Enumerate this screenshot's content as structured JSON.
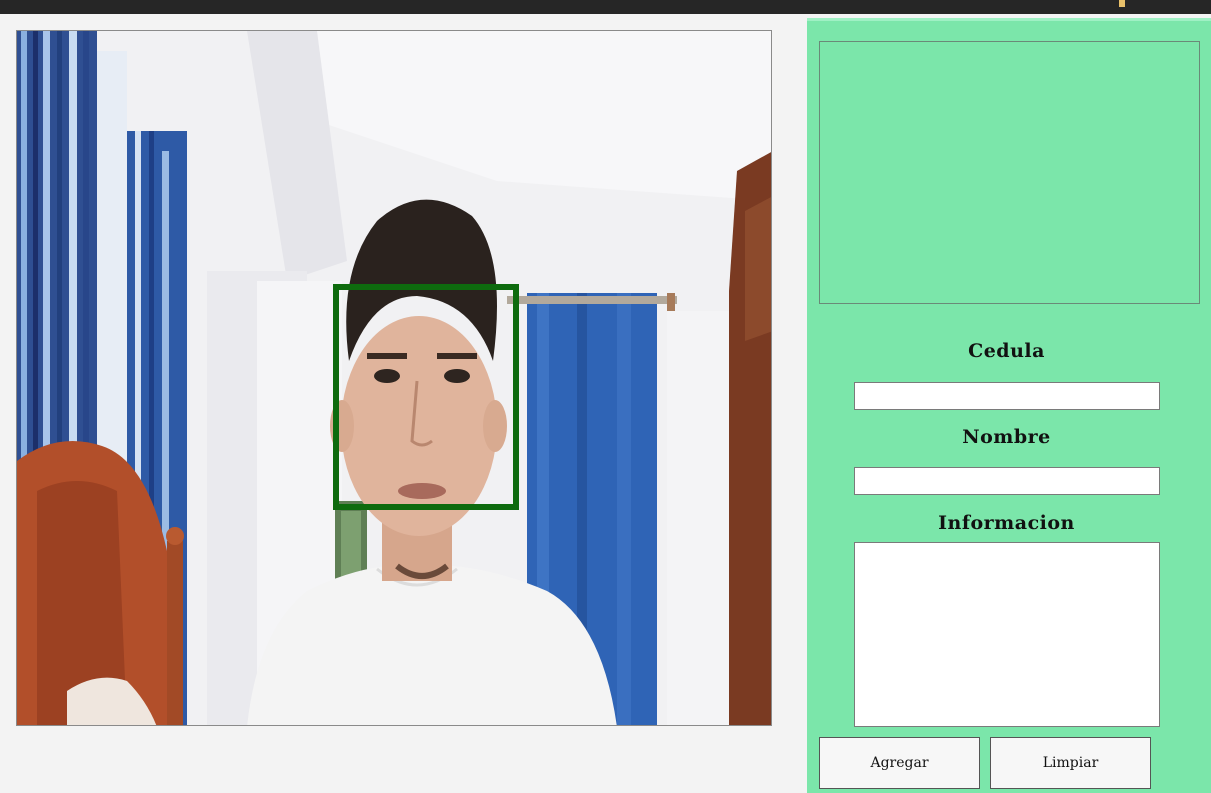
{
  "window": {
    "accent": "#262626"
  },
  "camera": {
    "face_box_color": "#0e6b0e"
  },
  "panel": {
    "background": "#7be6aa",
    "fields": {
      "cedula_label": "Cedula",
      "cedula_value": "",
      "nombre_label": "Nombre",
      "nombre_value": "",
      "informacion_label": "Informacion",
      "informacion_value": ""
    },
    "buttons": {
      "agregar_label": "Agregar",
      "limpiar_label": "Limpiar"
    }
  }
}
